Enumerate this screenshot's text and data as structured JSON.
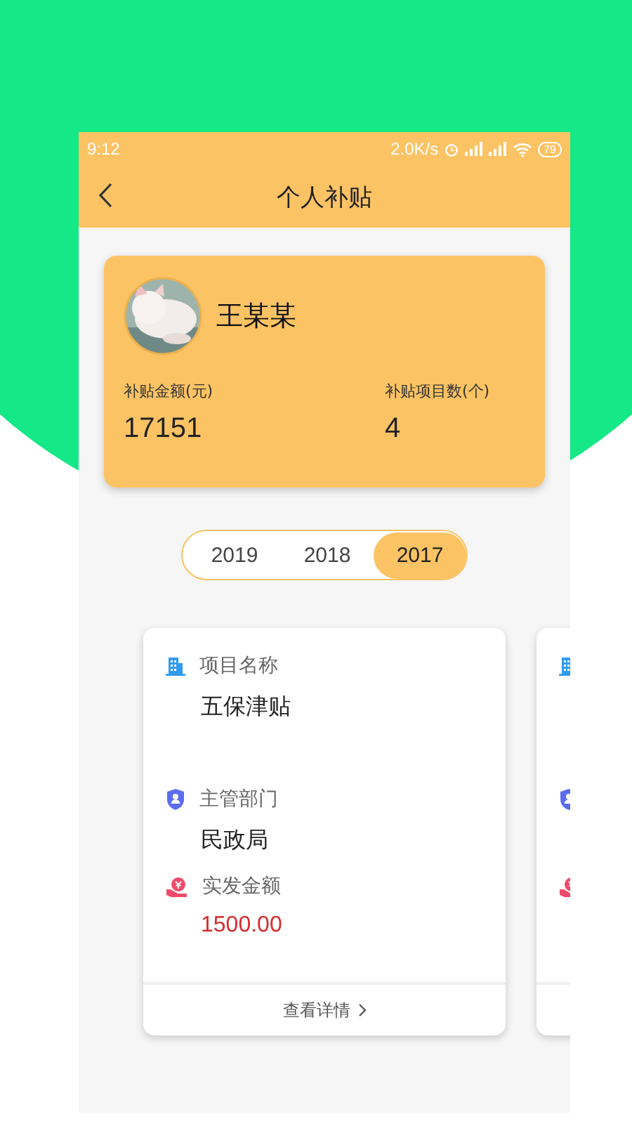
{
  "status_bar": {
    "time": "9:12",
    "speed": "2.0K/s",
    "battery": "79"
  },
  "header": {
    "title": "个人补贴"
  },
  "profile": {
    "name": "王某某",
    "stats": [
      {
        "label": "补贴金额(元)",
        "value": "17151"
      },
      {
        "label": "补贴项目数(个)",
        "value": "4"
      }
    ]
  },
  "years": [
    {
      "label": "2019",
      "selected": false
    },
    {
      "label": "2018",
      "selected": false
    },
    {
      "label": "2017",
      "selected": true
    }
  ],
  "cards": [
    {
      "fields": [
        {
          "kind": "building",
          "label": "项目名称",
          "value": "五保津贴"
        },
        {
          "kind": "shield",
          "label": "主管部门",
          "value": "民政局"
        },
        {
          "kind": "money",
          "label": "实发金额",
          "value": "1500.00"
        }
      ],
      "link": "查看详情"
    },
    {
      "fields": [
        {
          "kind": "building"
        },
        {
          "kind": "shield"
        },
        {
          "kind": "money"
        }
      ]
    }
  ]
}
